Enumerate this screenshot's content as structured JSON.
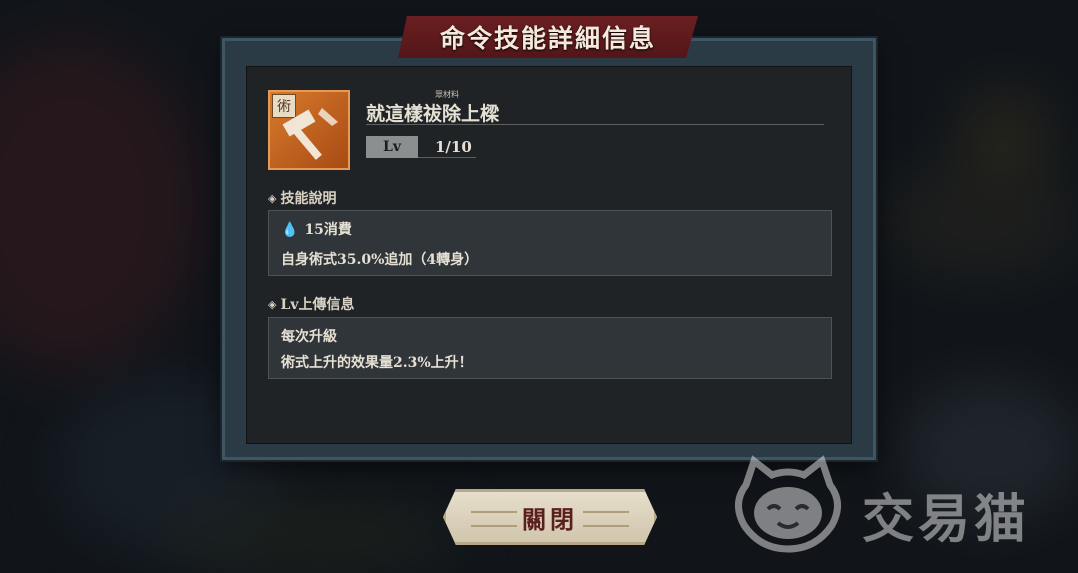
{
  "dialog": {
    "title": "命令技能詳細信息",
    "close_label": "關閉"
  },
  "skill": {
    "icon_tag": "術",
    "ruby": "眾材料",
    "name": "就這樣祓除上樑",
    "level_label": "Lv",
    "level_value": "1/10"
  },
  "description": {
    "header": "技能說明",
    "cost": "15消費",
    "effect": "自身術式35.0%追加（4轉身）"
  },
  "levelup": {
    "header": "Lv上傳信息",
    "line1": "每次升級",
    "line2": "術式上升的效果量2.3%上升！"
  },
  "watermark": {
    "text": "交易猫"
  },
  "colors": {
    "banner": "#6b1f22",
    "icon": "#d77a2c",
    "cost_drop": "#5fc4d6"
  }
}
